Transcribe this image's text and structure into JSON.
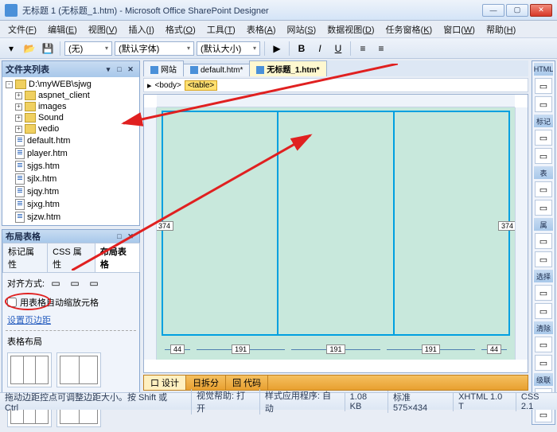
{
  "title": "无标题 1 (无标题_1.htm) - Microsoft Office SharePoint Designer",
  "menus": [
    {
      "label": "文件",
      "accel": "F"
    },
    {
      "label": "编辑",
      "accel": "E"
    },
    {
      "label": "视图",
      "accel": "V"
    },
    {
      "label": "插入",
      "accel": "I"
    },
    {
      "label": "格式",
      "accel": "O"
    },
    {
      "label": "工具",
      "accel": "T"
    },
    {
      "label": "表格",
      "accel": "A"
    },
    {
      "label": "网站",
      "accel": "S"
    },
    {
      "label": "数据视图",
      "accel": "D"
    },
    {
      "label": "任务窗格",
      "accel": "K"
    },
    {
      "label": "窗口",
      "accel": "W"
    },
    {
      "label": "帮助",
      "accel": "H"
    }
  ],
  "toolbar": {
    "style_combo": "(无)",
    "font_combo": "(默认字体)",
    "size_combo": "(默认大小)"
  },
  "folder_panel": {
    "title": "文件夹列表",
    "root": "D:\\myWEB\\sjwg",
    "folders": [
      "aspnet_client",
      "images",
      "Sound",
      "vedio"
    ],
    "files": [
      "default.htm",
      "player.htm",
      "sjgs.htm",
      "sjlx.htm",
      "sjqy.htm",
      "sjxg.htm",
      "sjzw.htm"
    ]
  },
  "layout_panel": {
    "title": "布局表格",
    "tabs": [
      "标记属性",
      "CSS 属性",
      "布局表格"
    ],
    "align_label": "对齐方式:",
    "checkbox_label": "用表格自动缩放元格",
    "margin_link": "设置页边距",
    "section": "表格布局"
  },
  "doc_tabs": [
    "网站",
    "default.htm*",
    "无标题_1.htm*"
  ],
  "tagbar": {
    "crumb": "<body>",
    "tag": "<table>"
  },
  "dims": {
    "height": "374",
    "small": "44",
    "col": "191"
  },
  "views": [
    "口 设计",
    "日拆分",
    "回 代码"
  ],
  "right_toolbox": {
    "heads": [
      "HTML",
      "标记",
      "表",
      "属",
      "选择",
      "清除",
      "级联"
    ]
  },
  "status": {
    "hint": "拖动边距控点可调整边距大小。按 Shift 或 Ctrl",
    "help": "视觉帮助: 打开",
    "mode": "样式应用程序: 自动",
    "size": "1.08 KB",
    "std": "标准  575×434",
    "xhtml": "XHTML 1.0 T",
    "css": "CSS 2.1"
  },
  "colors": {
    "accent": "#00a0e0",
    "annot": "#e02020"
  }
}
